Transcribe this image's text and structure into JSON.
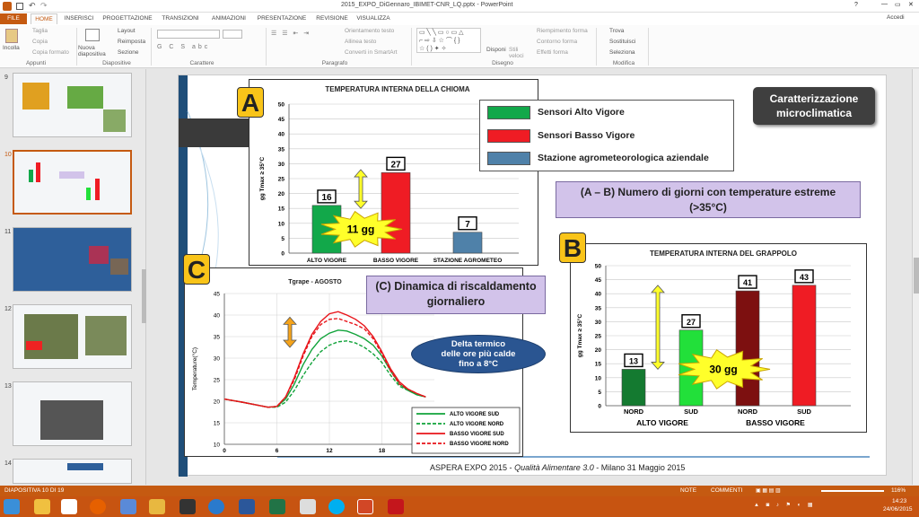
{
  "window": {
    "title": "2015_EXPO_DiGennaro_IBIMET-CNR_LQ.pptx - PowerPoint",
    "help": "?",
    "signin": "Accedi",
    "controls": [
      "—",
      "▭",
      "✕"
    ]
  },
  "tabs": [
    "FILE",
    "HOME",
    "INSERISCI",
    "PROGETTAZIONE",
    "TRANSIZIONI",
    "ANIMAZIONI",
    "PRESENTAZIONE",
    "REVISIONE",
    "VISUALIZZA"
  ],
  "ribbon": {
    "clipboard": {
      "paste": "Incolla",
      "cut": "Taglia",
      "copy": "Copia",
      "format": "Copia formato",
      "group": "Appunti"
    },
    "slides": {
      "new": "Nuova diapositiva",
      "layout": "Layout",
      "reset": "Reimposta",
      "section": "Sezione",
      "group": "Diapositive"
    },
    "font": {
      "group": "Carattere"
    },
    "paragraph": {
      "orient": "Orientamento testo",
      "align": "Allinea testo",
      "smartart": "Converti in SmartArt",
      "group": "Paragrafo"
    },
    "drawing": {
      "arrange": "Disponi",
      "styles": "Stili veloci",
      "fill": "Riempimento forma",
      "outline": "Contorno forma",
      "effects": "Effetti forma",
      "group": "Disegno"
    },
    "editing": {
      "find": "Trova",
      "replace": "Sostituisci",
      "select": "Seleziona",
      "group": "Modifica"
    }
  },
  "thumbnails": [
    {
      "num": "9"
    },
    {
      "num": "10"
    },
    {
      "num": "11"
    },
    {
      "num": "12"
    },
    {
      "num": "13"
    },
    {
      "num": "14"
    }
  ],
  "slide": {
    "badge": "Caratterizzazione microclimatica",
    "footer_a": "ASPERA EXPO 2015 - ",
    "footer_b": "Qualità Alimentare 3.0",
    "footer_c": " - Milano 31 Maggio 2015",
    "letters": {
      "a": "A",
      "b": "B",
      "c": "C"
    },
    "legend": [
      "Sensori Alto Vigore",
      "Sensori Basso Vigore",
      "Stazione agrometeorologica aziendale"
    ],
    "desc_ab": "(A – B) Numero di giorni con temperature estreme (>35°C)",
    "desc_c": "(C) Dinamica di riscaldamento giornaliero",
    "delta": "Delta termico delle ore più calde fino a 8°C",
    "burst_a": "11 gg",
    "burst_b": "30 gg"
  },
  "status": {
    "slide": "DIAPOSITIVA 10 DI 19",
    "notes": "NOTE",
    "comments": "COMMENTI",
    "zoom": "116%"
  },
  "clock": {
    "time": "14:23",
    "date": "24/06/2015"
  },
  "colors": {
    "accent": "#c55a11",
    "green": "#12a84a",
    "red": "#ef1c24",
    "blue": "#4f81a9",
    "darkred": "#7d1010",
    "lightgreen": "#22e03a",
    "darkgreen": "#147a30",
    "lavender": "#d2c3ea"
  },
  "chart_data": [
    {
      "type": "bar",
      "title": "TEMPERATURA INTERNA DELLA CHIOMA",
      "ylabel": "gg Tmax ≥ 35°C",
      "ylim": [
        0,
        50
      ],
      "categories": [
        "ALTO VIGORE",
        "BASSO VIGORE",
        "STAZIONE AGROMETEO"
      ],
      "values": [
        16,
        27,
        7
      ],
      "data_labels": [
        "16",
        "27",
        "7"
      ],
      "colors": [
        "#12a84a",
        "#ef1c24",
        "#4f81a9"
      ]
    },
    {
      "type": "bar",
      "title": "TEMPERATURA INTERNA DEL GRAPPOLO",
      "ylabel": "gg Tmax ≥ 35°C",
      "ylim": [
        0,
        50
      ],
      "categories": [
        "NORD",
        "SUD",
        "NORD",
        "SUD"
      ],
      "groups": [
        "ALTO VIGORE",
        "BASSO VIGORE"
      ],
      "values": [
        13,
        27,
        41,
        43
      ],
      "data_labels": [
        "13",
        "27",
        "41",
        "43"
      ],
      "colors": [
        "#147a30",
        "#22e03a",
        "#7d1010",
        "#ef1c24"
      ]
    },
    {
      "type": "line",
      "title": "Tgrape - AGOSTO",
      "ylabel": "Temperature(°C)",
      "ylim": [
        10,
        45
      ],
      "xlim": [
        0,
        24
      ],
      "xticks": [
        "0",
        "6",
        "12",
        "18"
      ],
      "yticks": [
        "10",
        "15",
        "20",
        "25",
        "30",
        "35",
        "40",
        "45"
      ],
      "x": [
        0,
        2,
        4,
        5,
        6,
        7,
        8,
        9,
        10,
        11,
        12,
        13,
        14,
        15,
        16,
        17,
        18,
        19,
        20,
        21,
        22,
        23
      ],
      "series": [
        {
          "name": "ALTO VIGORE SUD",
          "color": "#11a33a",
          "dash": false,
          "values": [
            20.5,
            19.8,
            19,
            18.6,
            18.8,
            20.5,
            24,
            28.5,
            32,
            34.5,
            35.8,
            36.5,
            36.3,
            35.5,
            34.5,
            33,
            30.5,
            27,
            24,
            22.5,
            21.5,
            21
          ]
        },
        {
          "name": "ALTO VIGORE NORD",
          "color": "#11a33a",
          "dash": true,
          "values": [
            20.5,
            19.8,
            19,
            18.6,
            18.6,
            19.8,
            22.5,
            26,
            29,
            31.5,
            33,
            33.8,
            34,
            33.5,
            32.5,
            31,
            29,
            26,
            23.5,
            22.5,
            21.5,
            21
          ]
        },
        {
          "name": "BASSO VIGORE SUD",
          "color": "#e8141a",
          "dash": false,
          "values": [
            20.5,
            19.8,
            19,
            18.6,
            18.8,
            21,
            25.5,
            31,
            35.5,
            38.5,
            40.3,
            40.8,
            40,
            39,
            37.5,
            35,
            31.5,
            27.5,
            24.5,
            22.8,
            21.8,
            21
          ]
        },
        {
          "name": "BASSO VIGORE NORD",
          "color": "#e8141a",
          "dash": true,
          "values": [
            20.5,
            19.8,
            19,
            18.6,
            18.8,
            21,
            25,
            30.5,
            35,
            37.8,
            39,
            39.2,
            38.5,
            37.8,
            36.8,
            34.5,
            31,
            27,
            24,
            22.8,
            21.8,
            21
          ]
        }
      ]
    }
  ]
}
